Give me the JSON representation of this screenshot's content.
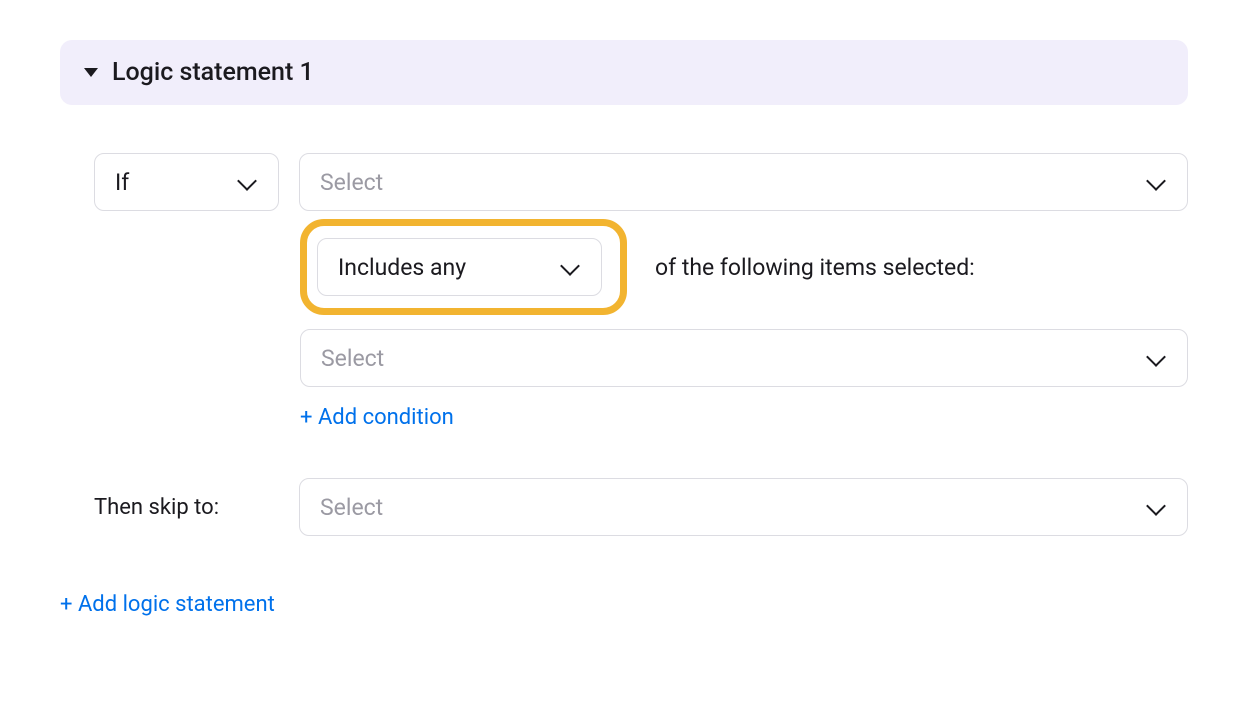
{
  "statement": {
    "title": "Logic statement 1",
    "if_label": "If",
    "question_select_placeholder": "Select",
    "includes_label": "Includes any",
    "includes_helper": "of the following items selected:",
    "items_select_placeholder": "Select",
    "add_condition": "+ Add condition",
    "then_label": "Then skip to:",
    "then_select_placeholder": "Select"
  },
  "add_logic_statement": "+ Add logic statement"
}
